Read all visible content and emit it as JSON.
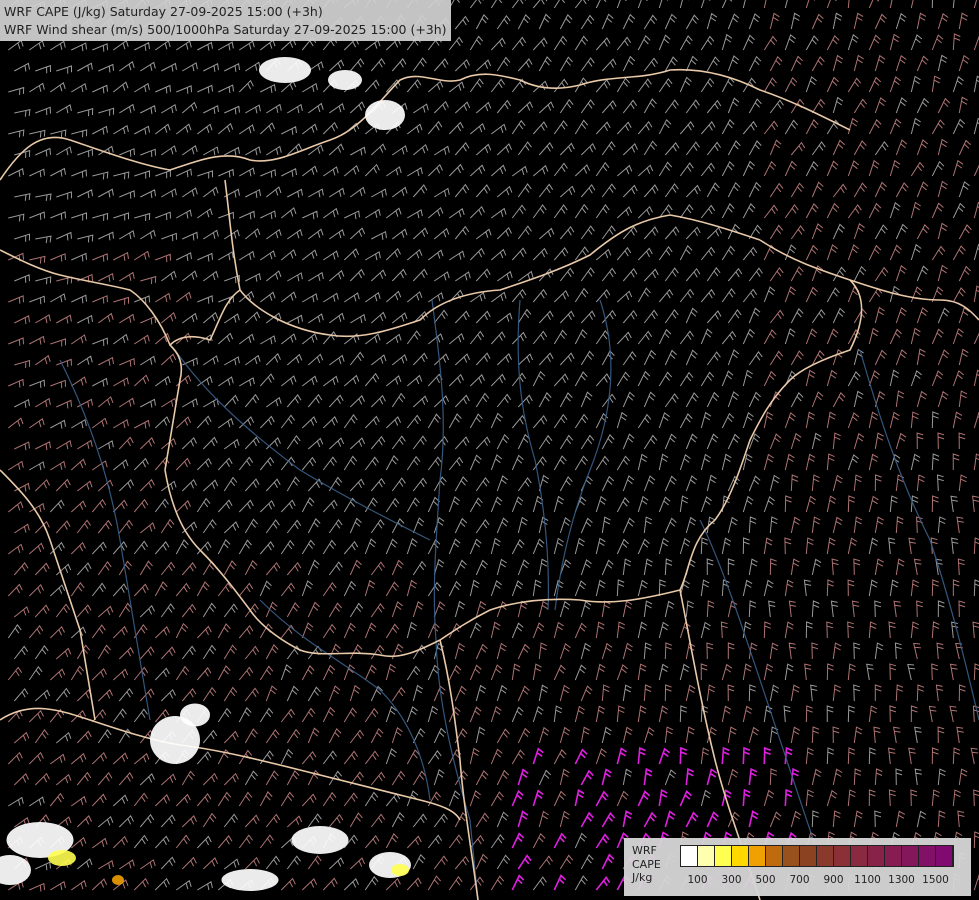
{
  "title": {
    "line1": "WRF CAPE (J/kg) Saturday 27-09-2025 15:00 (+3h)",
    "line2": "WRF Wind shear (m/s) 500/1000hPa Saturday 27-09-2025 15:00 (+3h)"
  },
  "legend": {
    "name_line1": "WRF",
    "name_line2": "CAPE",
    "name_line3": "J/kg",
    "swatches": [
      {
        "color": "#ffffff"
      },
      {
        "color": "#ffffb0"
      },
      {
        "color": "#ffff50"
      },
      {
        "color": "#ffd800"
      },
      {
        "color": "#f0a000"
      },
      {
        "color": "#c06a10"
      },
      {
        "color": "#98501c"
      },
      {
        "color": "#8a4220"
      },
      {
        "color": "#8a3a2c"
      },
      {
        "color": "#8a3036"
      },
      {
        "color": "#8a2a40"
      },
      {
        "color": "#882248"
      },
      {
        "color": "#861c52"
      },
      {
        "color": "#84165c"
      },
      {
        "color": "#821066"
      },
      {
        "color": "#800a70"
      }
    ],
    "ticks": [
      {
        "label": "100",
        "index": 0
      },
      {
        "label": "300",
        "index": 2
      },
      {
        "label": "500",
        "index": 4
      },
      {
        "label": "700",
        "index": 6
      },
      {
        "label": "900",
        "index": 8
      },
      {
        "label": "1100",
        "index": 10
      },
      {
        "label": "1300",
        "index": 12
      },
      {
        "label": "1500",
        "index": 14
      }
    ]
  },
  "colors": {
    "background": "#000000",
    "border": "#e8c9a8",
    "river": "#3a5f8a",
    "barb_low": "#b4b4b4",
    "barb_high": "#c08080",
    "barb_magenta": "#e020e0",
    "cape_patch": "#ffffff"
  }
}
